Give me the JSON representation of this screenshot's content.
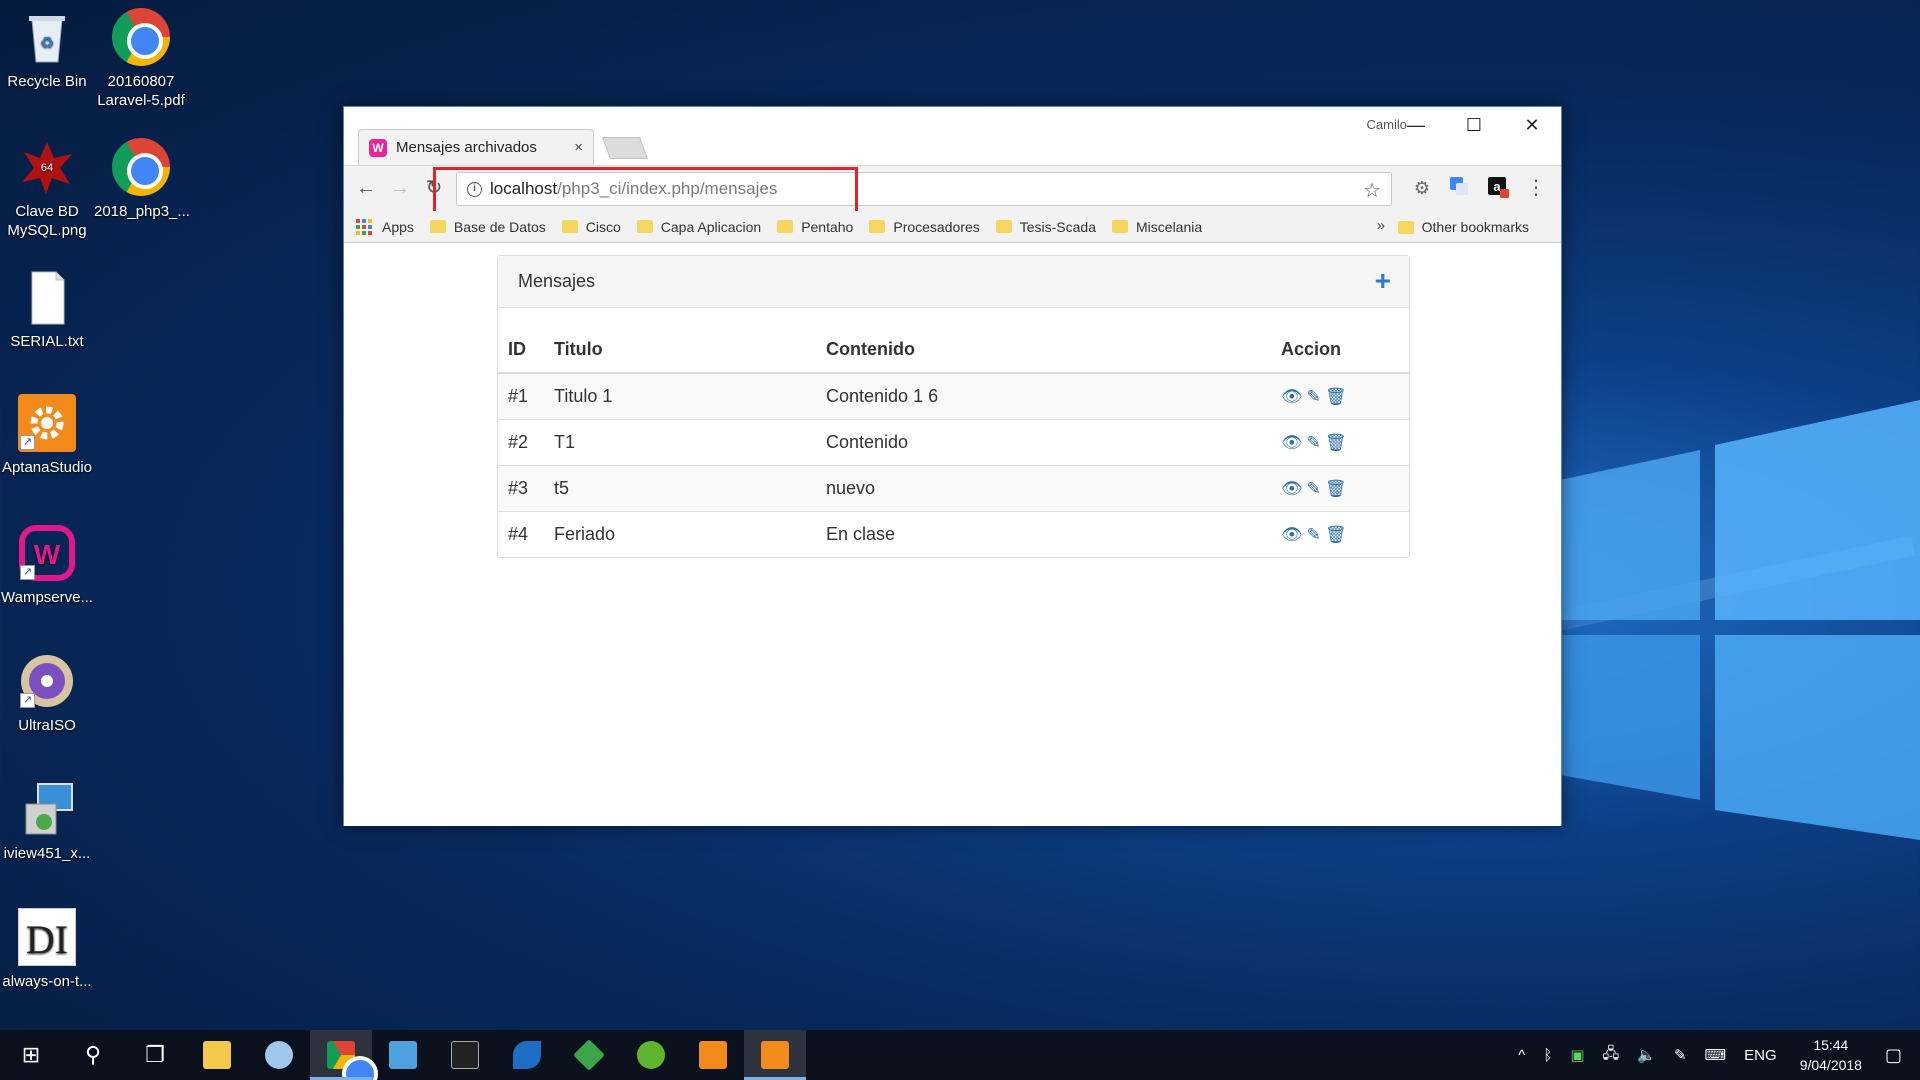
{
  "desktop": {
    "icons_left": [
      {
        "label": "Recycle Bin",
        "icon": "recycle-bin-icon"
      },
      {
        "label": "Clave BD\nMySQL.png",
        "icon": "image-icon"
      },
      {
        "label": "SERIAL.txt",
        "icon": "text-file-icon"
      },
      {
        "label": "AptanaStudio",
        "icon": "aptana-icon"
      },
      {
        "label": "Wampserve...",
        "icon": "wampserver-icon"
      },
      {
        "label": "UltraISO",
        "icon": "ultraiso-icon"
      },
      {
        "label": "iview451_x...",
        "icon": "installer-icon"
      },
      {
        "label": "always-on-t...",
        "icon": "di-icon"
      }
    ],
    "icons_right": [
      {
        "label": "20160807\nLaravel-5.pdf",
        "icon": "chrome-icon"
      },
      {
        "label": "2018_php3_...",
        "icon": "chrome-icon"
      }
    ],
    "badge_64": "64",
    "di_text": "DI",
    "wamp_letter": "W"
  },
  "browser": {
    "tab_title": "Mensajes archivados",
    "tab_close": "×",
    "profile_name": "Camilo",
    "window_controls": {
      "minimize": "—",
      "maximize": "☐",
      "close": "✕"
    },
    "url_host": "localhost",
    "url_path": "/php3_ci/index.php/mensajes",
    "info_glyph": "i",
    "star_glyph": "☆",
    "menu_glyph": "⋮",
    "nav": {
      "back": "←",
      "forward": "→",
      "reload": "↻"
    },
    "bookmarks": [
      {
        "label": "Apps",
        "type": "apps"
      },
      {
        "label": "Base de Datos",
        "type": "folder"
      },
      {
        "label": "Cisco",
        "type": "folder"
      },
      {
        "label": "Capa Aplicacion",
        "type": "folder"
      },
      {
        "label": "Pentaho",
        "type": "folder"
      },
      {
        "label": "Procesadores",
        "type": "folder"
      },
      {
        "label": "Tesis-Scada",
        "type": "folder"
      },
      {
        "label": "Miscelania",
        "type": "folder"
      }
    ],
    "bookmarks_more": "»",
    "other_bookmarks": "Other bookmarks",
    "accent": "#e0222a"
  },
  "page": {
    "panel_title": "Mensajes",
    "add_glyph": "+",
    "columns": [
      "ID",
      "Titulo",
      "Contenido",
      "Accion"
    ],
    "rows": [
      {
        "id": "#1",
        "titulo": "Titulo 1",
        "contenido": "Contenido 1 6"
      },
      {
        "id": "#2",
        "titulo": "T1",
        "contenido": "Contenido"
      },
      {
        "id": "#3",
        "titulo": "t5",
        "contenido": "nuevo"
      },
      {
        "id": "#4",
        "titulo": "Feriado",
        "contenido": "En clase"
      }
    ],
    "action_icons": {
      "view": "👁",
      "edit": "✎",
      "delete": "🗑"
    }
  },
  "taskbar": {
    "start_glyph": "⊞",
    "search_glyph": "⚲",
    "taskview_glyph": "❐",
    "tray": {
      "chevron": "^",
      "lang": "ENG",
      "time": "15:44",
      "date": "9/04/2018",
      "notif_glyph": "▢"
    }
  }
}
